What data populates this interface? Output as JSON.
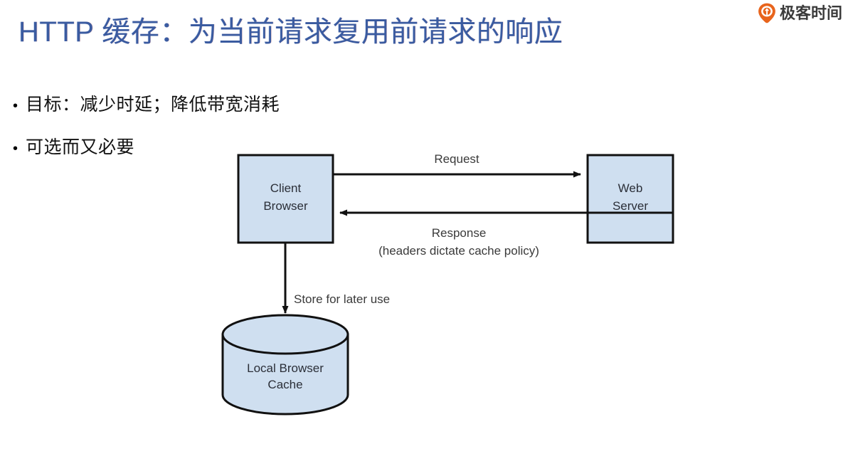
{
  "brand": {
    "name": "极客时间",
    "logo_icon": "geektime-pin-icon",
    "logo_color": "#e8641c"
  },
  "slide": {
    "title": "HTTP 缓存：为当前请求复用前请求的响应",
    "title_color": "#3a5ba0",
    "background_color": "#ffffff",
    "bullets": [
      {
        "marker": "•",
        "text": "目标：减少时延；降低带宽消耗"
      },
      {
        "marker": "•",
        "text": "可选而又必要"
      }
    ]
  },
  "diagram": {
    "fill_color": "#cfdff0",
    "stroke_color": "#1a1a1a",
    "nodes": {
      "client": {
        "line1": "Client",
        "line2": "Browser"
      },
      "server": {
        "line1": "Web",
        "line2": "Server"
      },
      "cache": {
        "line1": "Local Browser",
        "line2": "Cache"
      }
    },
    "edges": {
      "request": {
        "label": "Request",
        "direction": "client-to-server"
      },
      "response": {
        "label_line1": "Response",
        "label_line2": "(headers dictate cache policy)",
        "direction": "server-to-client"
      },
      "store": {
        "label": "Store for later use",
        "direction": "client-to-cache"
      }
    }
  }
}
